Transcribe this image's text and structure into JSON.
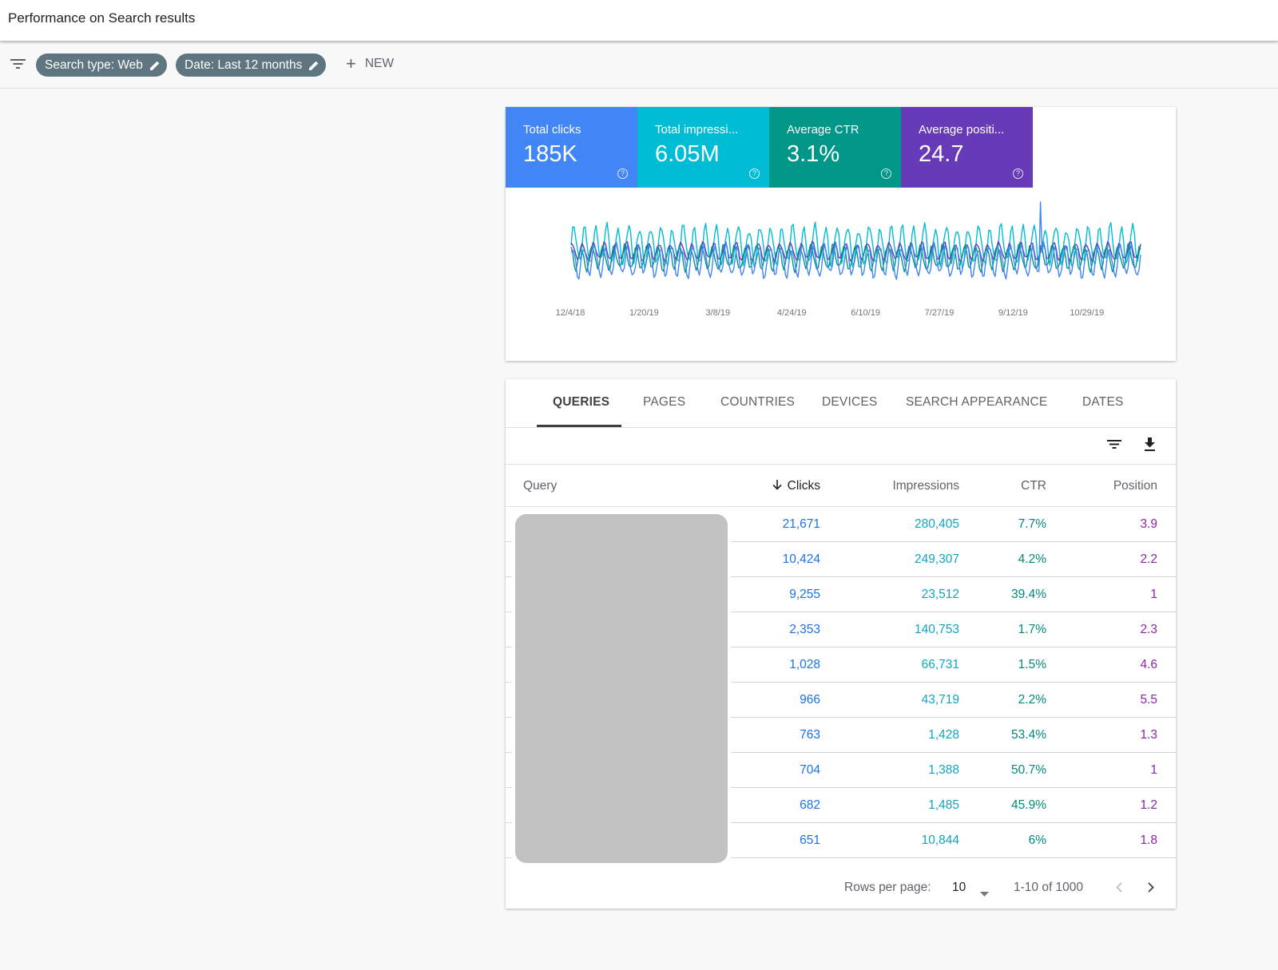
{
  "header": {
    "title": "Performance on Search results"
  },
  "filters": {
    "chips": [
      "Search type: Web",
      "Date: Last 12 months"
    ],
    "new_label": "NEW"
  },
  "metrics": [
    {
      "label": "Total clicks",
      "value": "185K",
      "color": "#4285f4"
    },
    {
      "label": "Total impressi...",
      "value": "6.05M",
      "color": "#00bcd4"
    },
    {
      "label": "Average CTR",
      "value": "3.1%",
      "color": "#009688"
    },
    {
      "label": "Average positi...",
      "value": "24.7",
      "color": "#673ab7"
    }
  ],
  "chart_data": {
    "type": "line",
    "x_ticks": [
      "12/4/18",
      "1/20/19",
      "3/8/19",
      "4/24/19",
      "6/10/19",
      "7/27/19",
      "9/12/19",
      "10/29/19"
    ],
    "series": [
      {
        "color": "#00bcd4"
      },
      {
        "color": "#673ab7"
      },
      {
        "color": "#009688"
      },
      {
        "color": "#4285f4"
      }
    ]
  },
  "tabs": [
    "QUERIES",
    "PAGES",
    "COUNTRIES",
    "DEVICES",
    "SEARCH APPEARANCE",
    "DATES"
  ],
  "table": {
    "headers": {
      "query": "Query",
      "clicks": "Clicks",
      "impressions": "Impressions",
      "ctr": "CTR",
      "position": "Position"
    },
    "rows": [
      {
        "clicks": "21,671",
        "impressions": "280,405",
        "ctr": "7.7%",
        "position": "3.9"
      },
      {
        "clicks": "10,424",
        "impressions": "249,307",
        "ctr": "4.2%",
        "position": "2.2"
      },
      {
        "clicks": "9,255",
        "impressions": "23,512",
        "ctr": "39.4%",
        "position": "1"
      },
      {
        "clicks": "2,353",
        "impressions": "140,753",
        "ctr": "1.7%",
        "position": "2.3"
      },
      {
        "clicks": "1,028",
        "impressions": "66,731",
        "ctr": "1.5%",
        "position": "4.6"
      },
      {
        "clicks": "966",
        "impressions": "43,719",
        "ctr": "2.2%",
        "position": "5.5"
      },
      {
        "clicks": "763",
        "impressions": "1,428",
        "ctr": "53.4%",
        "position": "1.3"
      },
      {
        "clicks": "704",
        "impressions": "1,388",
        "ctr": "50.7%",
        "position": "1"
      },
      {
        "clicks": "682",
        "impressions": "1,485",
        "ctr": "45.9%",
        "position": "1.2"
      },
      {
        "clicks": "651",
        "impressions": "10,844",
        "ctr": "6%",
        "position": "1.8"
      }
    ]
  },
  "footer": {
    "rows_per_page_label": "Rows per page:",
    "rows_per_page": "10",
    "range": "1-10 of 1000"
  }
}
